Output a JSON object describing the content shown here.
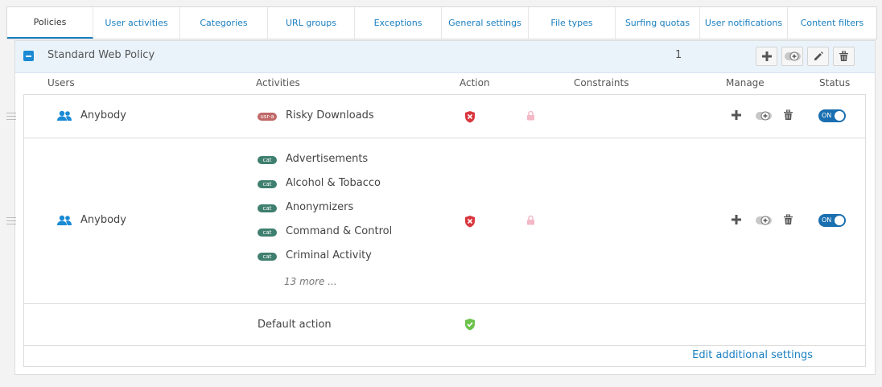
{
  "tabs": [
    {
      "label": "Policies",
      "active": true
    },
    {
      "label": "User activities"
    },
    {
      "label": "Categories"
    },
    {
      "label": "URL groups"
    },
    {
      "label": "Exceptions"
    },
    {
      "label": "General settings"
    },
    {
      "label": "File types"
    },
    {
      "label": "Surfing quotas"
    },
    {
      "label": "User notifications"
    },
    {
      "label": "Content filters"
    }
  ],
  "policy": {
    "name": "Standard Web Policy",
    "number": "1"
  },
  "columns": {
    "users": "Users",
    "activities": "Activities",
    "action": "Action",
    "constraints": "Constraints",
    "manage": "Manage",
    "status": "Status"
  },
  "rules": [
    {
      "user": "Anybody",
      "activities": [
        {
          "tag": "usr-a",
          "label": "Risky Downloads"
        }
      ],
      "status": "ON"
    },
    {
      "user": "Anybody",
      "activities": [
        {
          "tag": "cat",
          "label": "Advertisements"
        },
        {
          "tag": "cat",
          "label": "Alcohol & Tobacco"
        },
        {
          "tag": "cat",
          "label": "Anonymizers"
        },
        {
          "tag": "cat",
          "label": "Command & Control"
        },
        {
          "tag": "cat",
          "label": "Criminal Activity"
        }
      ],
      "more": "13 more ...",
      "status": "ON"
    }
  ],
  "default_action": {
    "label": "Default action"
  },
  "edit_link": "Edit additional settings",
  "colors": {
    "accent": "#1a7fc1",
    "block": "#d9363e",
    "allow": "#6cc24a",
    "toggle": "#1a6fb0"
  }
}
